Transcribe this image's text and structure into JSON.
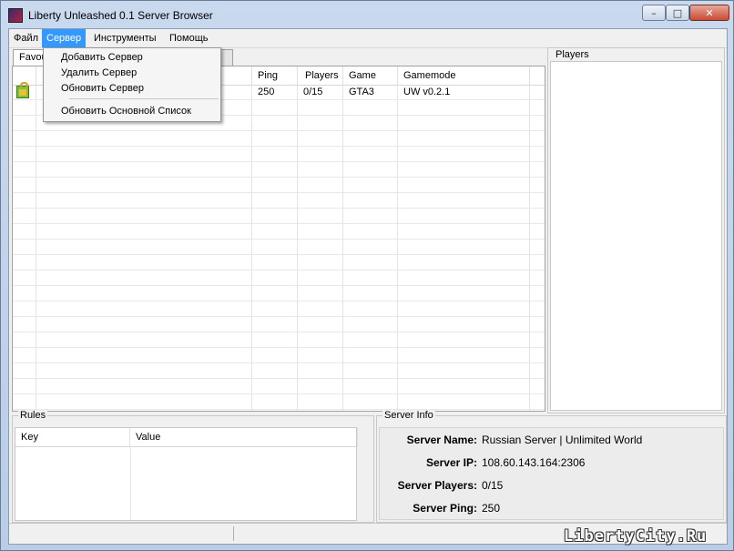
{
  "window": {
    "title": "Liberty Unleashed 0.1 Server Browser"
  },
  "menu": {
    "file": "Файл",
    "server": "Сервер",
    "tools": "Инструменты",
    "help": "Помощь"
  },
  "server_menu": {
    "add": "Добавить Сервер",
    "remove": "Удалить Сервер",
    "refresh": "Обновить Сервер",
    "refresh_master": "Обновить Основной Список"
  },
  "tabs": {
    "favourites": "Favou"
  },
  "server_list": {
    "columns": {
      "ping": "Ping",
      "players": "Players",
      "game": "Game",
      "gamemode": "Gamemode"
    },
    "rows": [
      {
        "ping": "250",
        "players": "0/15",
        "game": "GTA3",
        "gamemode": "UW v0.2.1"
      }
    ]
  },
  "players_panel": {
    "title": "Players"
  },
  "rules_panel": {
    "title": "Rules",
    "col_key": "Key",
    "col_value": "Value"
  },
  "server_info": {
    "title": "Server Info",
    "name_label": "Server Name:",
    "name": "Russian Server | Unlimited World",
    "ip_label": "Server IP:",
    "ip": "108.60.143.164:2306",
    "players_label": "Server Players:",
    "players": "0/15",
    "ping_label": "Server Ping:",
    "ping": "250"
  },
  "watermark": "LibertyCity.Ru"
}
